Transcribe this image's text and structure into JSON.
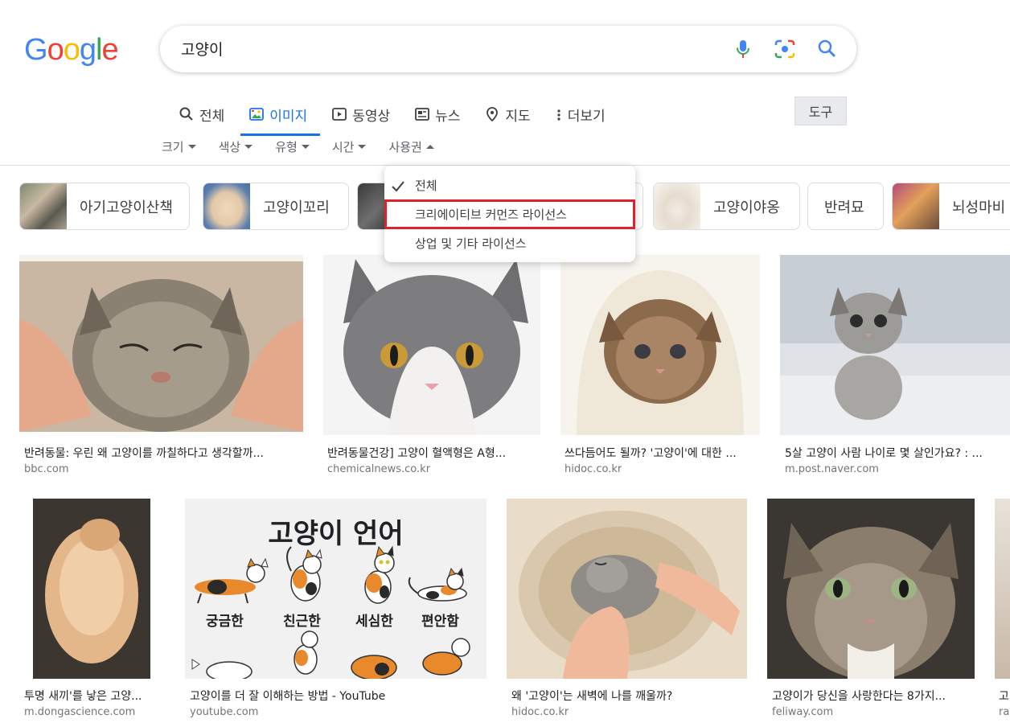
{
  "search": {
    "query": "고양이"
  },
  "logo": {
    "letters": [
      "G",
      "o",
      "o",
      "g",
      "l",
      "e"
    ],
    "colors": [
      "#4285f4",
      "#ea4335",
      "#fbbc05",
      "#4285f4",
      "#34a853",
      "#ea4335"
    ]
  },
  "icons": {
    "mic": "microphone-icon",
    "lens": "camera-lens-icon",
    "search": "search-icon"
  },
  "tabs": [
    {
      "label": "전체",
      "icon": "search-icon"
    },
    {
      "label": "이미지",
      "icon": "image-icon",
      "active": true
    },
    {
      "label": "동영상",
      "icon": "video-icon"
    },
    {
      "label": "뉴스",
      "icon": "news-icon"
    },
    {
      "label": "지도",
      "icon": "map-pin-icon"
    },
    {
      "label": "더보기",
      "icon": "more-vert-icon"
    }
  ],
  "tools_label": "도구",
  "filters": [
    "크기",
    "색상",
    "유형",
    "시간",
    "사용권"
  ],
  "chips": [
    "아기고양이산책",
    "고양이꼬리",
    "고양이야옹",
    "반려묘",
    "뇌성마비"
  ],
  "dropdown": {
    "items": [
      "전체",
      "크리에이티브 커먼즈 라이선스",
      "상업 및 기타 라이선스"
    ],
    "selected_index": 0,
    "highlighted_index": 1
  },
  "results": [
    {
      "caption": "반려동물: 우린 왜 고양이를 까칠하다고 생각할까...",
      "source": "bbc.com"
    },
    {
      "caption": "반려동물건강] 고양이 혈액형은 A형...",
      "source": "chemicalnews.co.kr"
    },
    {
      "caption": "쓰다듬어도 될까? '고양이'에 대한 ...",
      "source": "hidoc.co.kr"
    },
    {
      "caption": "5살 고양이 사람 나이로 몇 살인가요? : ...",
      "source": "m.post.naver.com"
    },
    {
      "caption": "투명 새끼'를 낳은 고양...",
      "source": "m.dongascience.com"
    },
    {
      "caption": "고양이를 더 잘 이해하는 방법 - YouTube",
      "source": "youtube.com"
    },
    {
      "caption": "왜 '고양이'는 새벽에 나를 깨울까?",
      "source": "hidoc.co.kr"
    },
    {
      "caption": "고양이가 당신을 사랑한다는 8가지...",
      "source": "feliway.com"
    },
    {
      "caption": "고",
      "source": "ra"
    }
  ],
  "cat_language": {
    "title": "고양이 언어",
    "labels": [
      "궁금한",
      "친근한",
      "세심한",
      "편안함"
    ]
  }
}
